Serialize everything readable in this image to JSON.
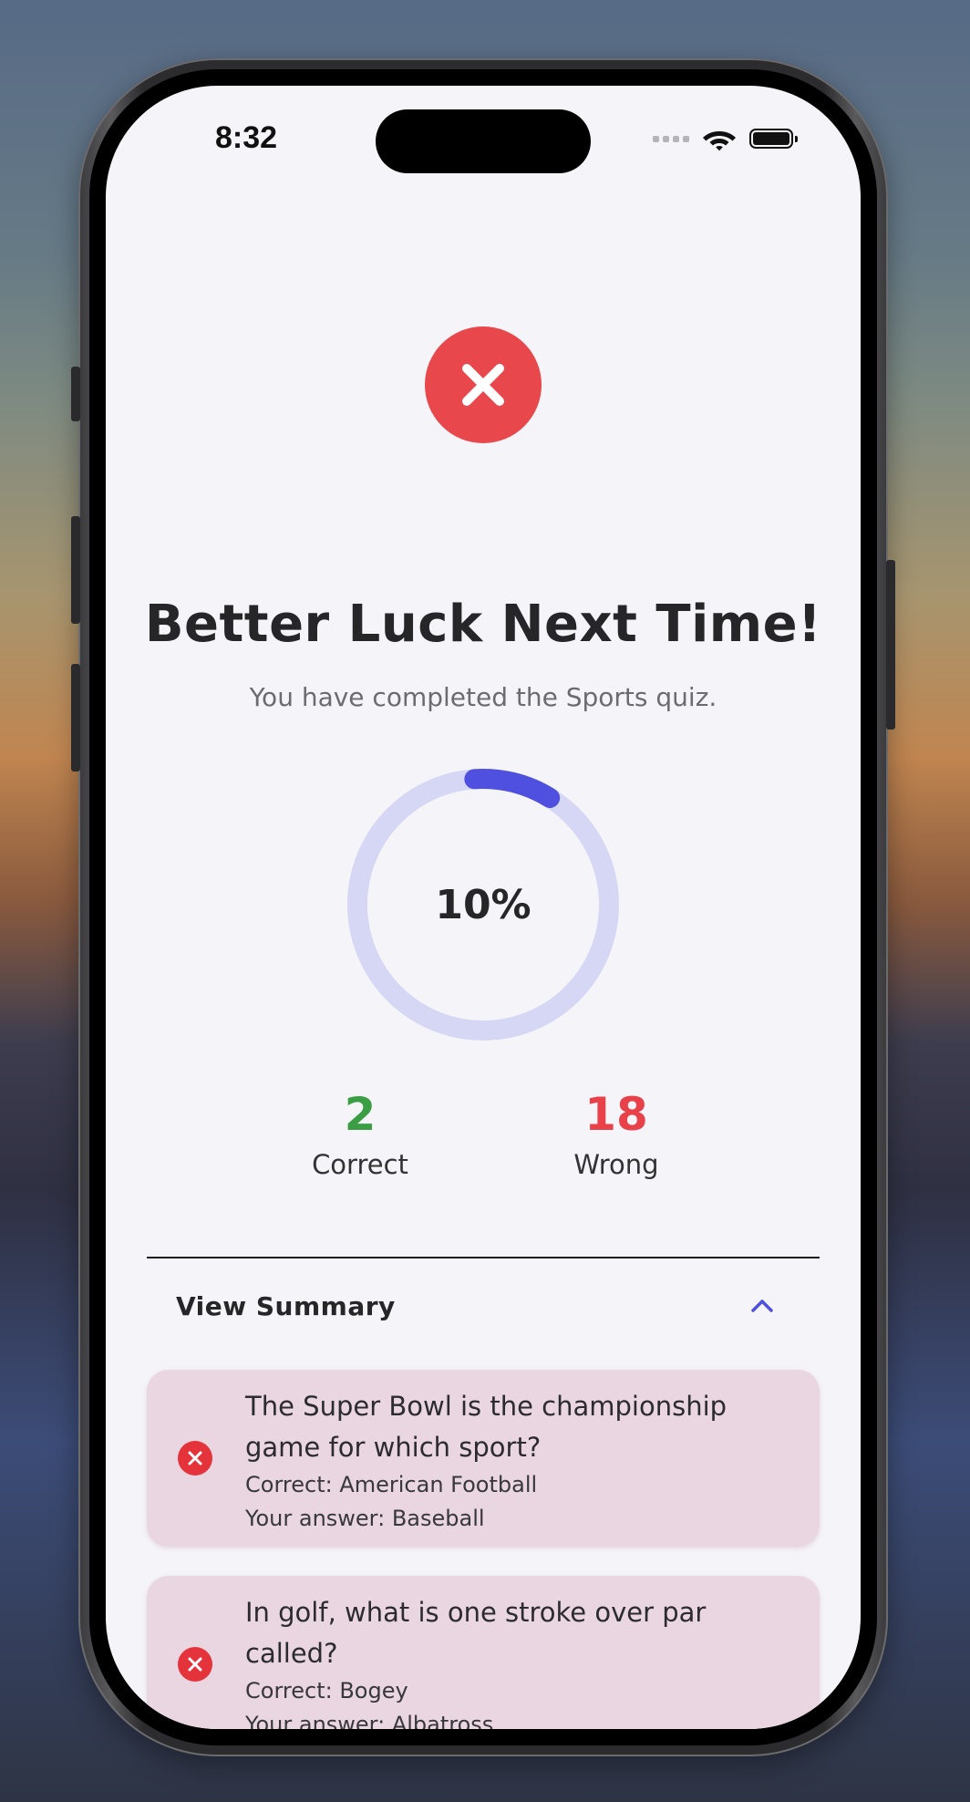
{
  "status_bar": {
    "time": "8:32"
  },
  "result": {
    "icon": "x-circle-icon",
    "title": "Better Luck Next Time!",
    "subtitle": "You have completed the Sports quiz.",
    "score_percent": 10,
    "score_label": "10%",
    "correct_count": "2",
    "correct_label": "Correct",
    "wrong_count": "18",
    "wrong_label": "Wrong"
  },
  "summary": {
    "toggle_label": "View Summary",
    "expanded": true,
    "items": [
      {
        "question": "The Super Bowl is the championship game for which sport?",
        "correct": "Correct: American Football",
        "your_answer": "Your answer: Baseball",
        "status": "wrong"
      },
      {
        "question": "In golf, what is one stroke over par called?",
        "correct": "Correct: Bogey",
        "your_answer": "Your answer: Albatross",
        "status": "wrong"
      }
    ]
  },
  "colors": {
    "error_red": "#e8474b",
    "correct_green": "#3b9e44",
    "wrong_red": "#e8414a",
    "accent_indigo": "#4f4fe0",
    "ring_track": "#d6d6f5",
    "card_background": "#ead6e1",
    "screen_background": "#f5f5f9"
  }
}
